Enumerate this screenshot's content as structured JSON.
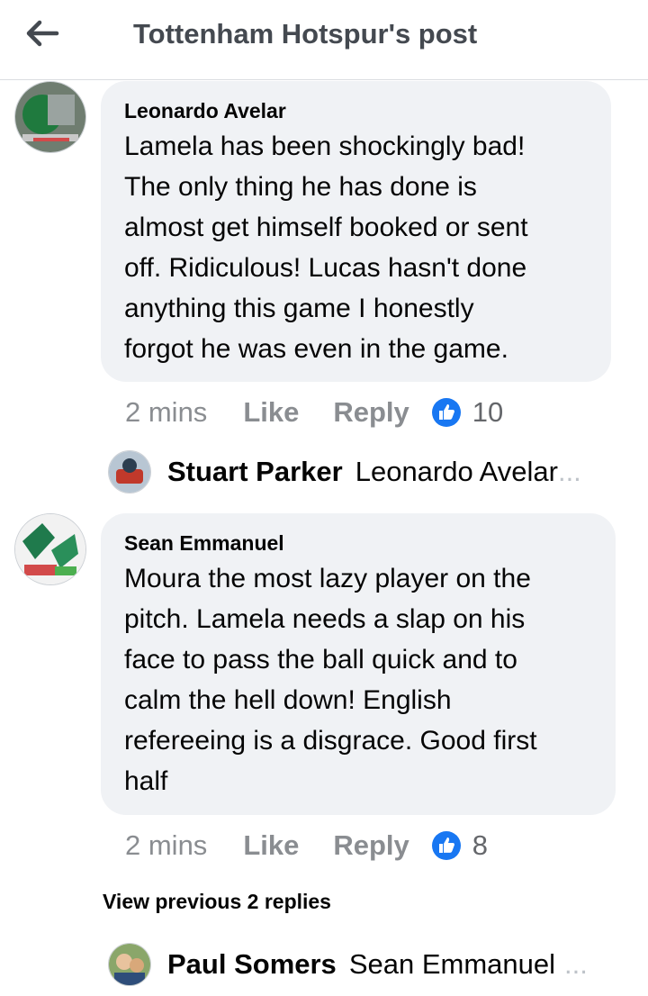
{
  "header": {
    "title": "Tottenham Hotspur's post"
  },
  "comments": [
    {
      "author": "Leonardo Avelar",
      "text": "Lamela has been shockingly bad!\nThe only thing he has done is\nalmost get himself booked or sent\noff. Ridiculous! Lucas hasn't done\nanything this game I honestly\nforgot he was even in the game.",
      "time": "2 mins",
      "like_label": "Like",
      "reply_label": "Reply",
      "reaction_count": "10",
      "reply_preview": {
        "name": "Stuart Parker",
        "snippet": "Leonardo Avelar",
        "ellipsis": "..."
      }
    },
    {
      "author": "Sean Emmanuel",
      "text": "Moura the most lazy player on the\npitch. Lamela needs a slap on his\nface to pass the ball quick and to\ncalm the hell down! English\nrefereeing is a disgrace. Good first\nhalf",
      "time": "2 mins",
      "like_label": "Like",
      "reply_label": "Reply",
      "reaction_count": "8",
      "view_previous": "View previous 2 replies",
      "reply_preview": {
        "name": "Paul Somers",
        "snippet": "Sean Emmanuel",
        "ellipsis": "..."
      }
    }
  ],
  "icons": {
    "back": "arrow-left-icon",
    "reaction": "thumbs-up-icon"
  },
  "colors": {
    "bubble": "#f0f2f5",
    "like_blue": "#1877f2",
    "meta_gray": "#8a8d91"
  }
}
